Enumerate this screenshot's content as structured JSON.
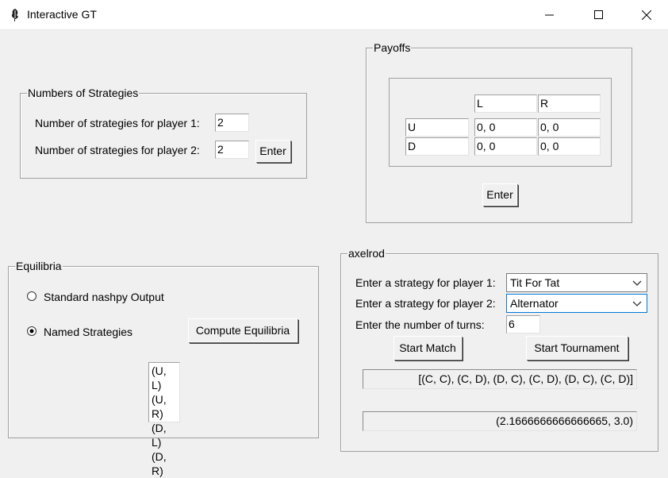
{
  "window": {
    "title": "Interactive GT",
    "icon": "feather-icon",
    "controls": [
      "minimize-icon",
      "maximize-icon",
      "close-icon"
    ]
  },
  "numbers_of_strategies": {
    "legend": "Numbers of Strategies",
    "player1_label": "Number of strategies for player 1:",
    "player1_value": "2",
    "player2_label": "Number of strategies for player 2:",
    "player2_value": "2",
    "enter_label": "Enter"
  },
  "payoffs": {
    "legend": "Payoffs",
    "col_headers": [
      "L",
      "R"
    ],
    "rows": [
      {
        "name": "U",
        "cells": [
          "0, 0",
          "0, 0"
        ]
      },
      {
        "name": "D",
        "cells": [
          "0, 0",
          "0, 0"
        ]
      }
    ],
    "enter_label": "Enter"
  },
  "equilibria": {
    "legend": "Equilibria",
    "options": [
      {
        "label": "Standard nashpy Output",
        "selected": false
      },
      {
        "label": "Named Strategies",
        "selected": true
      }
    ],
    "compute_label": "Compute Equilibria",
    "results": [
      "(U, L)",
      "(U, R)",
      "(D, L)",
      "(D, R)"
    ]
  },
  "axelrod": {
    "legend": "axelrod",
    "player1_label": "Enter a strategy for player 1:",
    "player1_strategy": "Tit For Tat",
    "player2_label": "Enter a strategy for player 2:",
    "player2_strategy": "Alternator",
    "turns_label": "Enter the number of turns:",
    "turns_value": "6",
    "start_match_label": "Start Match",
    "start_tournament_label": "Start Tournament",
    "match_output": "[(C, C), (C, D), (D, C), (C, D), (D, C), (C, D)]",
    "score_output": "(2.1666666666666665, 3.0)"
  }
}
